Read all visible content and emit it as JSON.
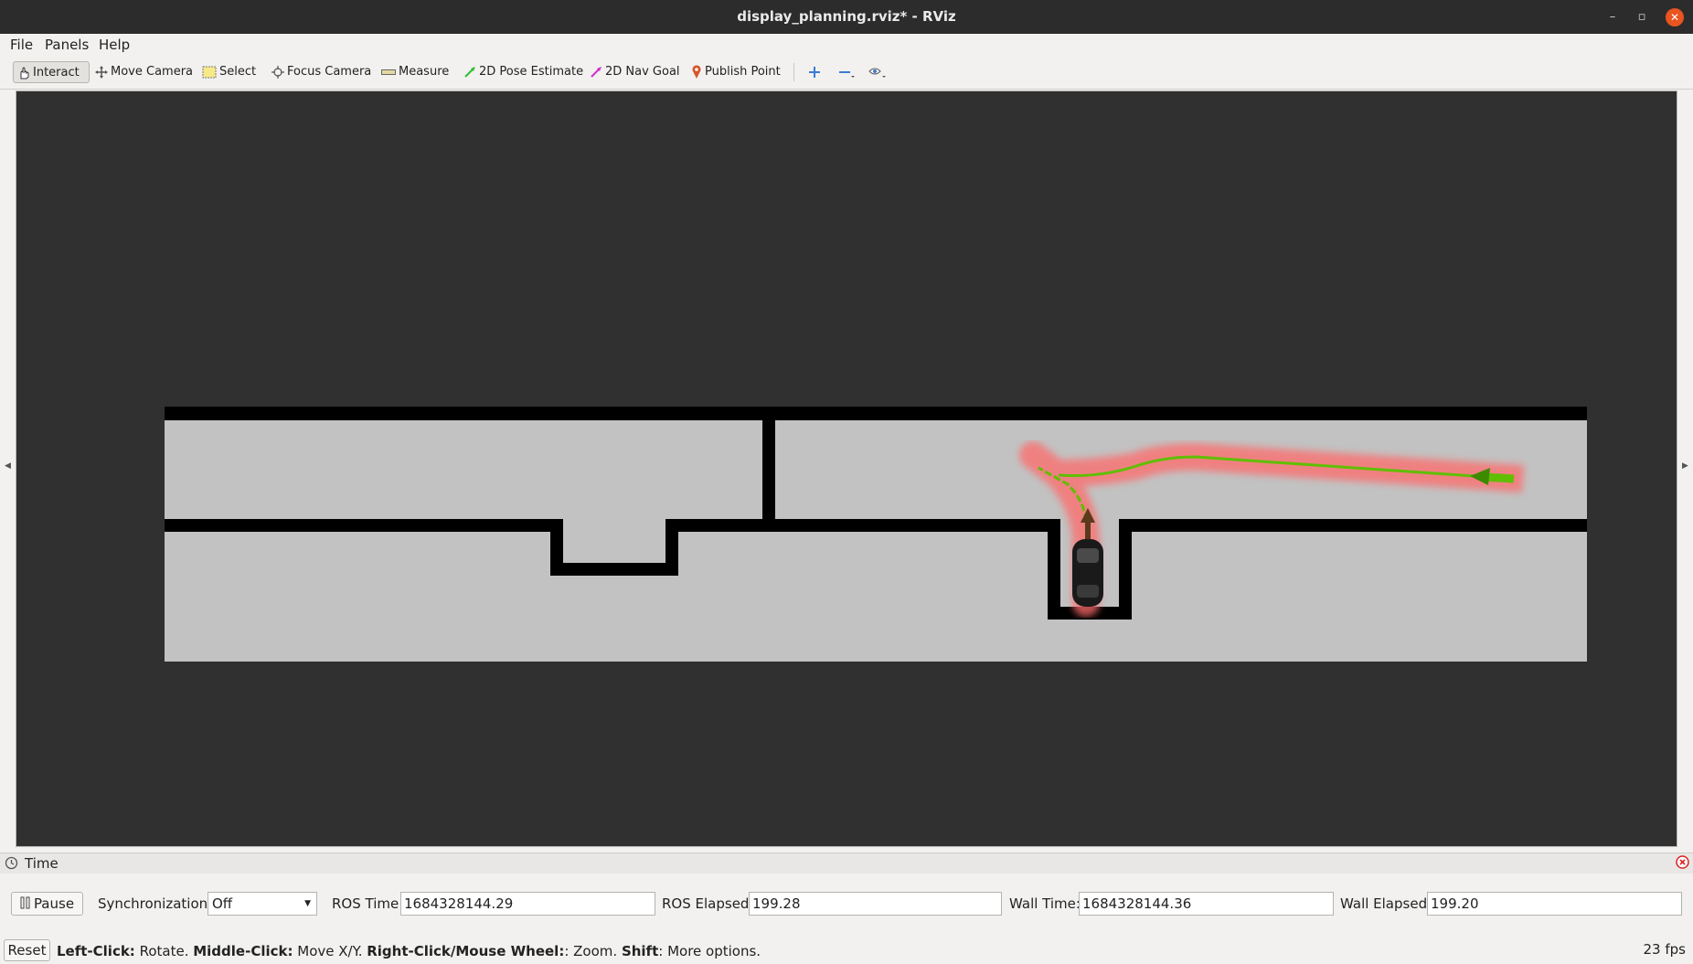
{
  "window": {
    "title": "display_planning.rviz* - RViz",
    "minimize_glyph": "–",
    "maximize_glyph": "▫",
    "close_glyph": "✕"
  },
  "menu": {
    "file": "File",
    "panels": "Panels",
    "help": "Help"
  },
  "toolbar": {
    "interact": "Interact",
    "move_camera": "Move Camera",
    "select": "Select",
    "focus_camera": "Focus Camera",
    "measure": "Measure",
    "pose_estimate": "2D Pose Estimate",
    "nav_goal": "2D Nav Goal",
    "publish_point": "Publish Point",
    "icons": [
      "hand-icon",
      "move-camera-icon",
      "select-box-icon",
      "focus-camera-icon",
      "ruler-icon",
      "pose-arrow-icon",
      "goal-arrow-icon",
      "map-pin-icon",
      "add-tool-icon",
      "remove-tool-icon",
      "eye-icon"
    ]
  },
  "viewport": {
    "background_color": "#303030",
    "map_free_color": "#c2c2c2",
    "wall_color": "#000000",
    "path_color": "#5fbf00",
    "footprint_color": "#ff6060"
  },
  "time_panel": {
    "title": "Time",
    "pause_label": "Pause",
    "sync_label": "Synchronization:",
    "sync_value": "Off",
    "ros_time_label": "ROS Time:",
    "ros_time_value": "1684328144.29",
    "ros_elapsed_label": "ROS Elapsed:",
    "ros_elapsed_value": "199.28",
    "wall_time_label": "Wall Time:",
    "wall_time_value": "1684328144.36",
    "wall_elapsed_label": "Wall Elapsed:",
    "wall_elapsed_value": "199.20"
  },
  "status": {
    "reset_label": "Reset",
    "hint_left_key": "Left-Click:",
    "hint_left_action": " Rotate. ",
    "hint_middle_key": "Middle-Click:",
    "hint_middle_action": " Move X/Y. ",
    "hint_right_key": "Right-Click/Mouse Wheel:",
    "hint_right_action": ": Zoom. ",
    "hint_shift_key": "Shift",
    "hint_shift_action": ": More options.",
    "fps": "23 fps"
  }
}
